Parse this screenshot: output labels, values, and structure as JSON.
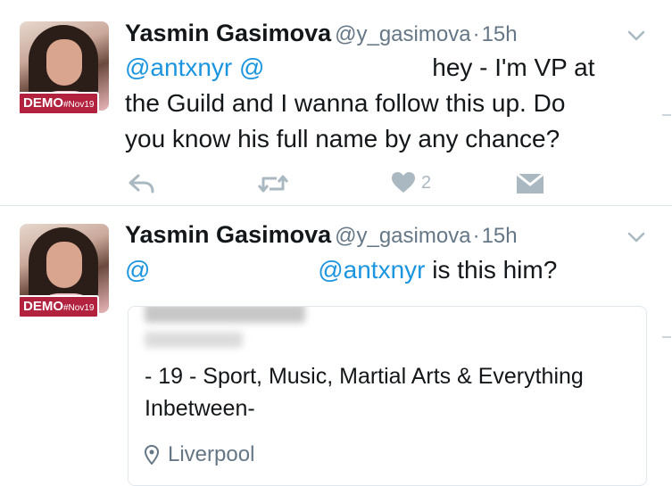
{
  "tweets": [
    {
      "author": {
        "name": "Yasmin Gasimova",
        "handle": "@y_gasimova",
        "badge_main": "DEMO",
        "badge_tag": "#Nov19"
      },
      "separator": "·",
      "time": "15h",
      "mention_1": "@antxnyr",
      "mention_2": "@",
      "text_line1_rest": "hey - I'm VP at",
      "text_line2": "the Guild and I wanna follow this up. Do",
      "text_line3": "you know his full name by any chance?",
      "actions": {
        "reply_icon": "reply-icon",
        "retweet_icon": "retweet-icon",
        "like_icon": "heart-icon",
        "like_count": "2",
        "dm_icon": "envelope-icon"
      }
    },
    {
      "author": {
        "name": "Yasmin Gasimova",
        "handle": "@y_gasimova",
        "badge_main": "DEMO",
        "badge_tag": "#Nov19"
      },
      "separator": "·",
      "time": "15h",
      "mention_1": "@",
      "mention_2": "@antxnyr",
      "text_rest": "is this him?",
      "card": {
        "bio": "- 19 - Sport, Music, Martial Arts & Everything Inbetween-",
        "location": "Liverpool",
        "location_icon": "map-pin-icon"
      }
    }
  ],
  "colors": {
    "link": "#1b95e0",
    "muted": "#657786",
    "action": "#aab8c2",
    "badge": "#b2213e"
  }
}
